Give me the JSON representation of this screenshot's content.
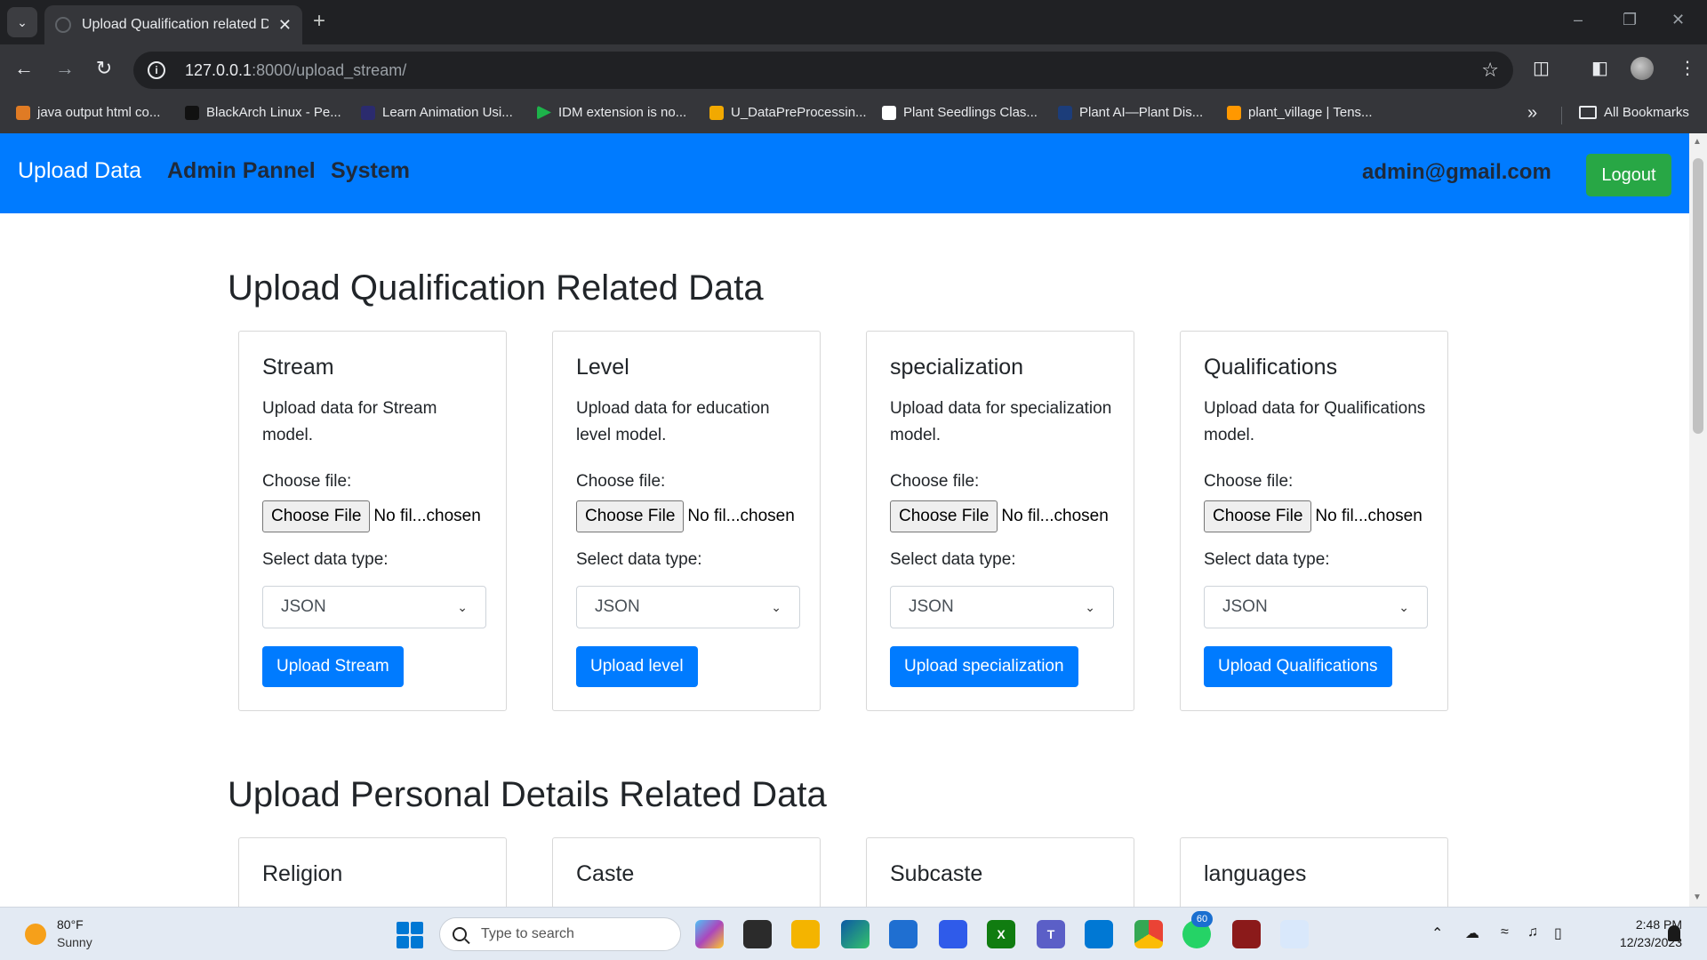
{
  "browser": {
    "tab_title": "Upload Qualification related Da",
    "url_host": "127.0.0.1",
    "url_path": ":8000/upload_stream/",
    "bookmarks": [
      {
        "label": "java output html co...",
        "color": "#e07b24"
      },
      {
        "label": "BlackArch Linux - Pe...",
        "color": "#111111"
      },
      {
        "label": "Learn Animation Usi...",
        "color": "#2b2b6e"
      },
      {
        "label": "IDM extension is no...",
        "color": "#1db34a"
      },
      {
        "label": "U_DataPreProcessin...",
        "color": "#f2a900"
      },
      {
        "label": "Plant Seedlings Clas...",
        "color": "#ffffff"
      },
      {
        "label": "Plant AI—Plant Dis...",
        "color": "#1c3d7a"
      },
      {
        "label": "plant_village  |  Tens...",
        "color": "#ff9800"
      }
    ],
    "all_bookmarks": "All Bookmarks"
  },
  "navbar": {
    "brand": "Upload Data",
    "links": [
      "Admin Pannel",
      "System"
    ],
    "user": "admin@gmail.com",
    "logout": "Logout"
  },
  "sections": [
    {
      "title": "Upload Qualification Related Data",
      "cards": [
        {
          "title": "Stream",
          "description": "Upload data for Stream model.",
          "file_label": "Choose file:",
          "file_button": "Choose File",
          "file_status": "No fil...chosen",
          "type_label": "Select data type:",
          "type_value": "JSON",
          "button": "Upload Stream"
        },
        {
          "title": "Level",
          "description": "Upload data for education level model.",
          "file_label": "Choose file:",
          "file_button": "Choose File",
          "file_status": "No fil...chosen",
          "type_label": "Select data type:",
          "type_value": "JSON",
          "button": "Upload level"
        },
        {
          "title": "specialization",
          "description": "Upload data for specialization model.",
          "file_label": "Choose file:",
          "file_button": "Choose File",
          "file_status": "No fil...chosen",
          "type_label": "Select data type:",
          "type_value": "JSON",
          "button": "Upload specialization"
        },
        {
          "title": "Qualifications",
          "description": "Upload data for Qualifications model.",
          "file_label": "Choose file:",
          "file_button": "Choose File",
          "file_status": "No fil...chosen",
          "type_label": "Select data type:",
          "type_value": "JSON",
          "button": "Upload Qualifications"
        }
      ]
    },
    {
      "title": "Upload Personal Details Related Data",
      "cards": [
        {
          "title": "Religion"
        },
        {
          "title": "Caste"
        },
        {
          "title": "Subcaste"
        },
        {
          "title": "languages"
        }
      ]
    }
  ],
  "taskbar": {
    "weather_temp": "80°F",
    "weather_cond": "Sunny",
    "search_placeholder": "Type to search",
    "whatsapp_badge": "60",
    "time": "2:48 PM",
    "date": "12/23/2023"
  },
  "colors": {
    "navbar": "#007bff",
    "logout": "#28a745",
    "primary_button": "#007bff"
  }
}
